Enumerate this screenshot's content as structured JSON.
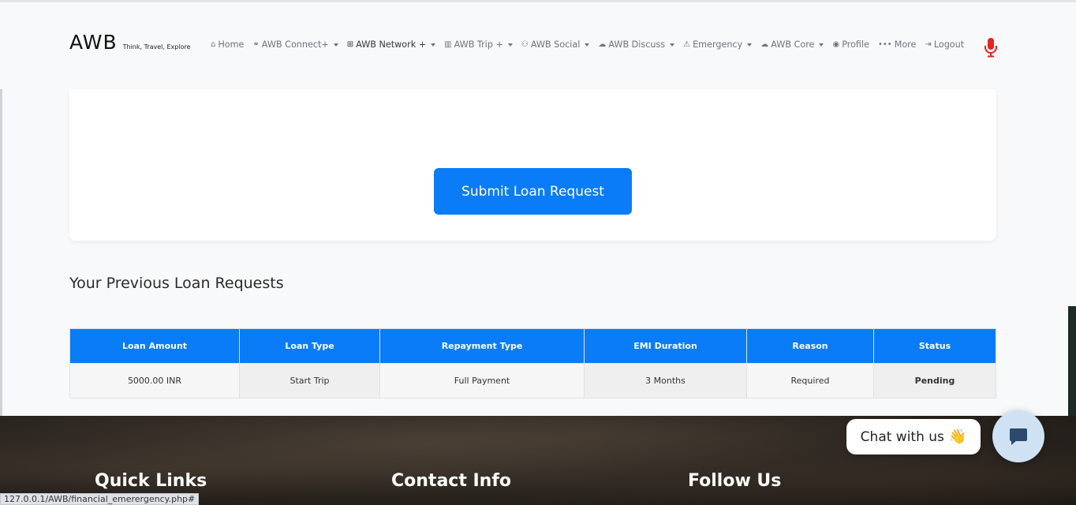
{
  "brand": {
    "name": "AWB",
    "tagline": "Think, Travel, Explore"
  },
  "nav": [
    {
      "label": "Home",
      "icon": "home-icon",
      "glyph": "⌂",
      "dropdown": false
    },
    {
      "label": "AWB Connect+",
      "icon": "link-icon",
      "glyph": "⚭",
      "dropdown": true
    },
    {
      "label": "AWB Network +",
      "icon": "sitemap-icon",
      "glyph": "⊞",
      "dropdown": true,
      "active": true
    },
    {
      "label": "AWB Trip +",
      "icon": "map-icon",
      "glyph": "▥",
      "dropdown": true
    },
    {
      "label": "AWB Social",
      "icon": "users-icon",
      "glyph": "⚇",
      "dropdown": true
    },
    {
      "label": "AWB Discuss",
      "icon": "comments-icon",
      "glyph": "☁",
      "dropdown": true
    },
    {
      "label": "Emergency",
      "icon": "warning-icon",
      "glyph": "⚠",
      "dropdown": true
    },
    {
      "label": "AWB Core",
      "icon": "comments-icon",
      "glyph": "☁",
      "dropdown": true
    },
    {
      "label": "Profile",
      "icon": "user-circle-icon",
      "glyph": "◉",
      "dropdown": false
    },
    {
      "label": "More",
      "icon": "ellipsis-icon",
      "glyph": "•••",
      "dropdown": false
    },
    {
      "label": "Logout",
      "icon": "logout-icon",
      "glyph": "⇥",
      "dropdown": false
    }
  ],
  "mic": {
    "icon": "microphone-icon",
    "color": "#e52222"
  },
  "form": {
    "submit_label": "Submit Loan Request"
  },
  "previous": {
    "title": "Your Previous Loan Requests",
    "columns": [
      "Loan Amount",
      "Loan Type",
      "Repayment Type",
      "EMI Duration",
      "Reason",
      "Status"
    ],
    "rows": [
      [
        "5000.00 INR",
        "Start Trip",
        "Full Payment",
        "3 Months",
        "Required",
        "Pending"
      ]
    ]
  },
  "footer": {
    "quick_links": "Quick Links",
    "contact_info": "Contact Info",
    "follow_us": "Follow Us"
  },
  "chat": {
    "label": "Chat with us",
    "emoji": "👋",
    "icon": "chat-icon"
  },
  "status_bar": {
    "url": "127.0.0.1/AWB/financial_emerergency.php#"
  },
  "colors": {
    "primary": "#0a7cf8",
    "pending": "#f5b524"
  }
}
